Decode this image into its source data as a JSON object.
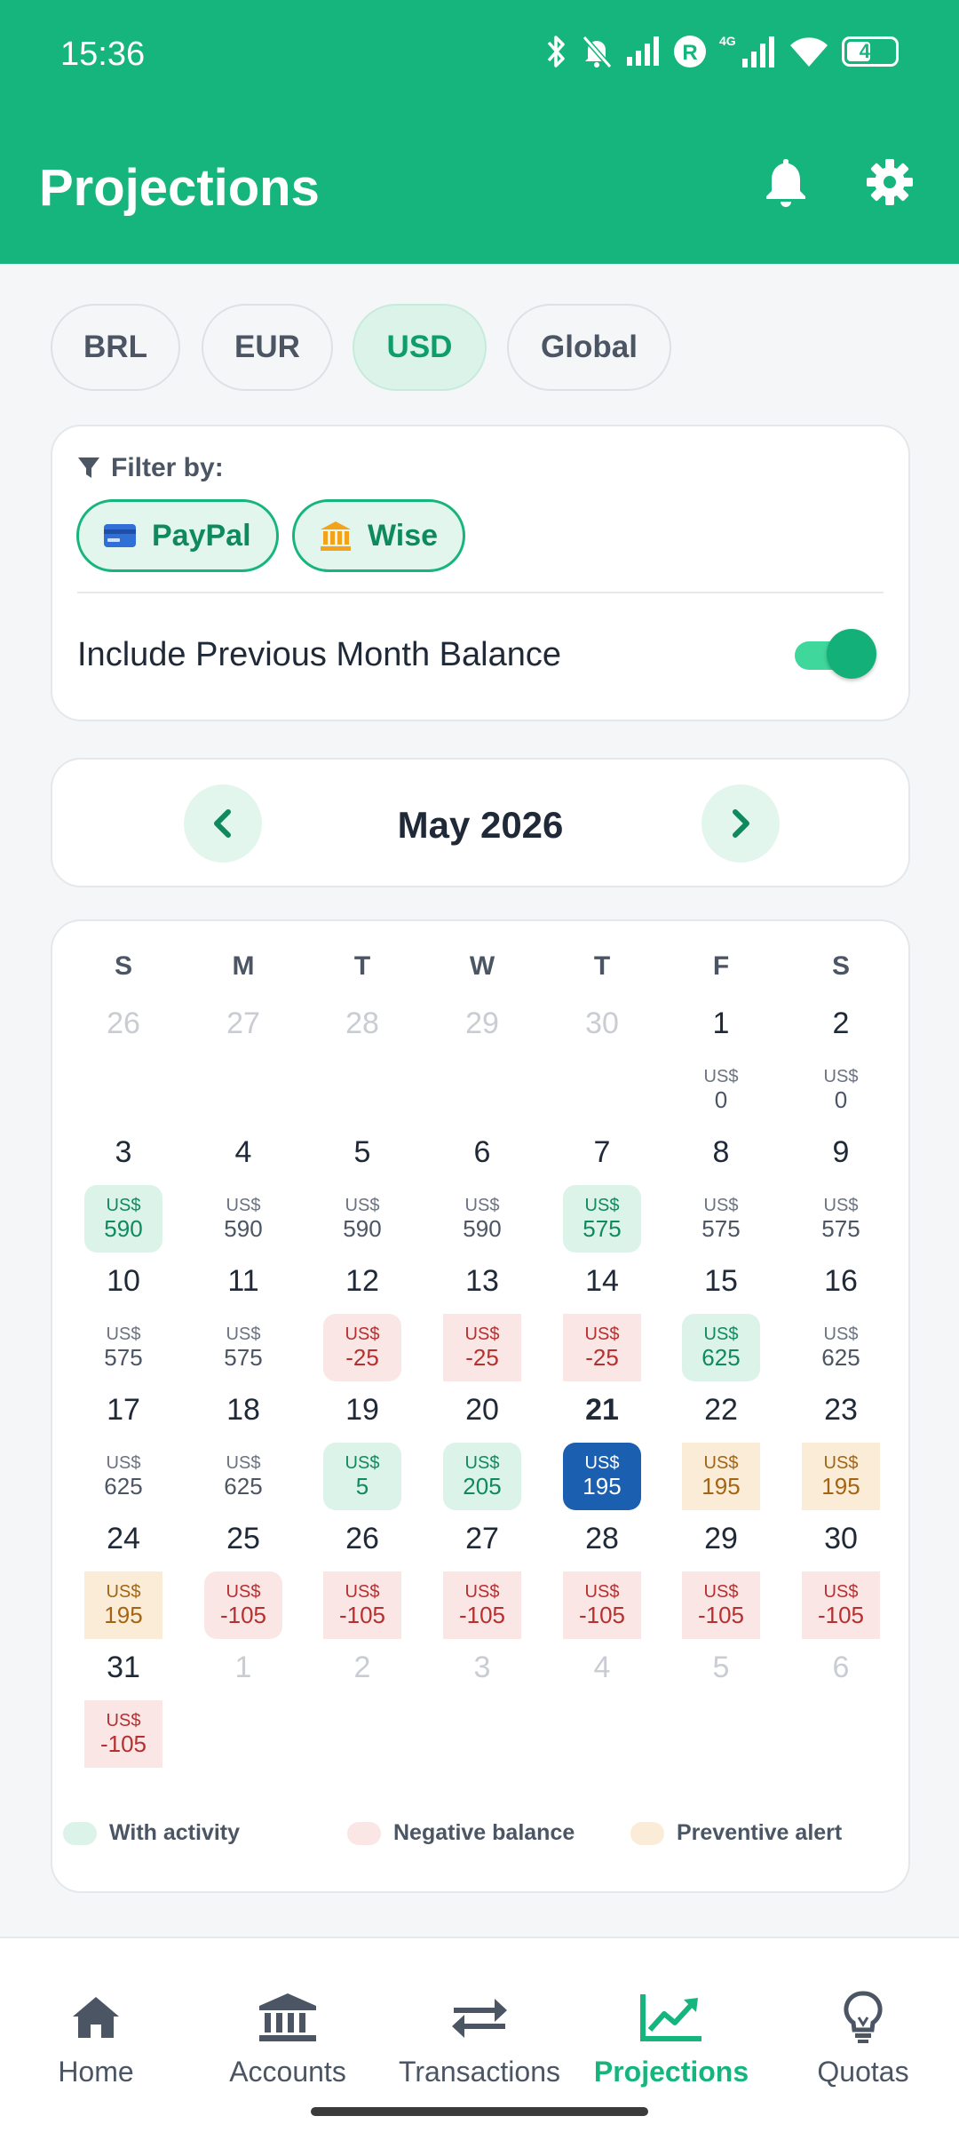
{
  "status_bar": {
    "time": "15:36",
    "battery": "48",
    "network": "4G"
  },
  "header": {
    "title": "Projections",
    "icons": [
      "bell-icon",
      "gear-icon"
    ]
  },
  "currencies": [
    {
      "label": "BRL",
      "active": false
    },
    {
      "label": "EUR",
      "active": false
    },
    {
      "label": "USD",
      "active": true
    },
    {
      "label": "Global",
      "active": false
    }
  ],
  "filter": {
    "label": "Filter by:",
    "accounts": [
      {
        "label": "PayPal",
        "icon": "credit-card-icon"
      },
      {
        "label": "Wise",
        "icon": "bank-icon"
      }
    ],
    "toggle_label": "Include Previous Month Balance",
    "toggle_on": true
  },
  "month": {
    "title": "May 2026"
  },
  "calendar": {
    "weekdays": [
      "S",
      "M",
      "T",
      "W",
      "T",
      "F",
      "S"
    ],
    "currency": "US$",
    "weeks": [
      [
        {
          "day": "26",
          "muted": true
        },
        {
          "day": "27",
          "muted": true
        },
        {
          "day": "28",
          "muted": true
        },
        {
          "day": "29",
          "muted": true
        },
        {
          "day": "30",
          "muted": true
        },
        {
          "day": "1",
          "value": "0",
          "status": "plain"
        },
        {
          "day": "2",
          "value": "0",
          "status": "plain"
        }
      ],
      [
        {
          "day": "3",
          "value": "590",
          "status": "activity"
        },
        {
          "day": "4",
          "value": "590",
          "status": "plain"
        },
        {
          "day": "5",
          "value": "590",
          "status": "plain"
        },
        {
          "day": "6",
          "value": "590",
          "status": "plain"
        },
        {
          "day": "7",
          "value": "575",
          "status": "activity"
        },
        {
          "day": "8",
          "value": "575",
          "status": "plain"
        },
        {
          "day": "9",
          "value": "575",
          "status": "plain"
        }
      ],
      [
        {
          "day": "10",
          "value": "575",
          "status": "plain"
        },
        {
          "day": "11",
          "value": "575",
          "status": "plain"
        },
        {
          "day": "12",
          "value": "-25",
          "status": "negative-activity"
        },
        {
          "day": "13",
          "value": "-25",
          "status": "negative"
        },
        {
          "day": "14",
          "value": "-25",
          "status": "negative"
        },
        {
          "day": "15",
          "value": "625",
          "status": "activity"
        },
        {
          "day": "16",
          "value": "625",
          "status": "plain"
        }
      ],
      [
        {
          "day": "17",
          "value": "625",
          "status": "plain"
        },
        {
          "day": "18",
          "value": "625",
          "status": "plain"
        },
        {
          "day": "19",
          "value": "5",
          "status": "activity"
        },
        {
          "day": "20",
          "value": "205",
          "status": "activity"
        },
        {
          "day": "21",
          "value": "195",
          "status": "today"
        },
        {
          "day": "22",
          "value": "195",
          "status": "alert"
        },
        {
          "day": "23",
          "value": "195",
          "status": "alert"
        }
      ],
      [
        {
          "day": "24",
          "value": "195",
          "status": "alert"
        },
        {
          "day": "25",
          "value": "-105",
          "status": "negative-activity"
        },
        {
          "day": "26",
          "value": "-105",
          "status": "negative"
        },
        {
          "day": "27",
          "value": "-105",
          "status": "negative"
        },
        {
          "day": "28",
          "value": "-105",
          "status": "negative"
        },
        {
          "day": "29",
          "value": "-105",
          "status": "negative"
        },
        {
          "day": "30",
          "value": "-105",
          "status": "negative"
        }
      ],
      [
        {
          "day": "31",
          "value": "-105",
          "status": "negative"
        },
        {
          "day": "1",
          "muted": true
        },
        {
          "day": "2",
          "muted": true
        },
        {
          "day": "3",
          "muted": true
        },
        {
          "day": "4",
          "muted": true
        },
        {
          "day": "5",
          "muted": true
        },
        {
          "day": "6",
          "muted": true
        }
      ]
    ]
  },
  "legend": [
    {
      "label": "With activity",
      "color": "#dcf3e9"
    },
    {
      "label": "Negative balance",
      "color": "#fbe6e6"
    },
    {
      "label": "Preventive alert",
      "color": "#fbecd7"
    }
  ],
  "bottom_nav": [
    {
      "label": "Home",
      "icon": "home-icon",
      "active": false
    },
    {
      "label": "Accounts",
      "icon": "bank-icon",
      "active": false
    },
    {
      "label": "Transactions",
      "icon": "swap-arrows-icon",
      "active": false
    },
    {
      "label": "Projections",
      "icon": "trending-up-icon",
      "active": true
    },
    {
      "label": "Quotas",
      "icon": "lightbulb-icon",
      "active": false
    }
  ],
  "colors": {
    "brand": "#17b57e",
    "today": "#1a5fb0"
  }
}
